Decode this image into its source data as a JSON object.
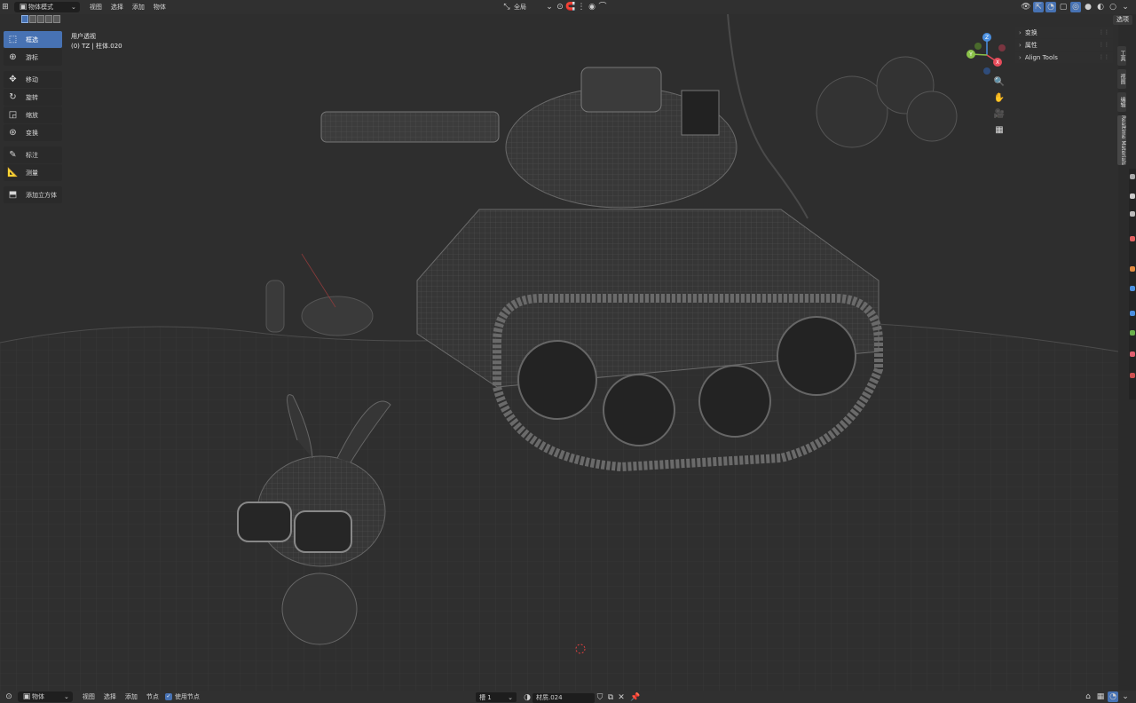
{
  "header": {
    "mode_label": "物体模式",
    "menus": [
      "视图",
      "选择",
      "添加",
      "物体"
    ],
    "transform_orientation": "全局",
    "options_label": "选项"
  },
  "toolbar": {
    "tools": [
      {
        "label": "框选",
        "icon": "select-box-icon"
      },
      {
        "label": "游标",
        "icon": "cursor-icon"
      },
      {
        "label": "移动",
        "icon": "move-icon"
      },
      {
        "label": "旋转",
        "icon": "rotate-icon"
      },
      {
        "label": "缩放",
        "icon": "scale-icon"
      },
      {
        "label": "变换",
        "icon": "transform-icon"
      },
      {
        "label": "标注",
        "icon": "annotate-icon"
      },
      {
        "label": "测量",
        "icon": "measure-icon"
      },
      {
        "label": "添加立方体",
        "icon": "add-cube-icon"
      }
    ]
  },
  "viewport": {
    "view_name": "用户透视",
    "object_info": "(0) TZ | 柱体.020"
  },
  "npanel": {
    "rows": [
      "变换",
      "属性",
      "Align Tools"
    ]
  },
  "side_tabs": [
    "工具",
    "视图",
    "编辑",
    "Realtime Materials"
  ],
  "footer": {
    "editor_label": "物体",
    "menus": [
      "视图",
      "选择",
      "添加",
      "节点"
    ],
    "use_nodes_label": "使用节点",
    "slot_label": "槽 1",
    "material_name": "材质.024"
  },
  "colors": {
    "accent": "#4772b3",
    "axis_x": "#e74c5b",
    "axis_y": "#8bc24a",
    "axis_z": "#4a8fe0"
  }
}
